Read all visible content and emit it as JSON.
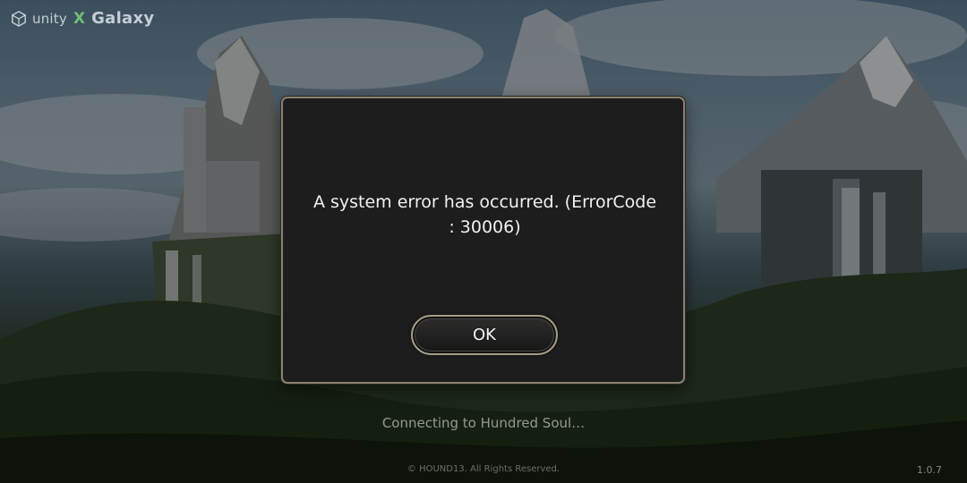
{
  "brand": {
    "unity_text": "unity",
    "separator": "X",
    "galaxy_text": "Galaxy"
  },
  "dialog": {
    "message": "A system error has occurred. (ErrorCode : 30006)",
    "ok_label": "OK"
  },
  "status": {
    "loading_text": "Connecting to Hundred Soul…"
  },
  "footer": {
    "copyright": "© HOUND13. All Rights Reserved.",
    "version": "1.0.7"
  },
  "colors": {
    "dialog_background": "#1d1d1e",
    "dialog_border": "#8a8170",
    "button_border": "#a79c86",
    "text_primary": "#f1f1f1"
  },
  "icons": {
    "unity_logo": "unity-cube-icon"
  }
}
